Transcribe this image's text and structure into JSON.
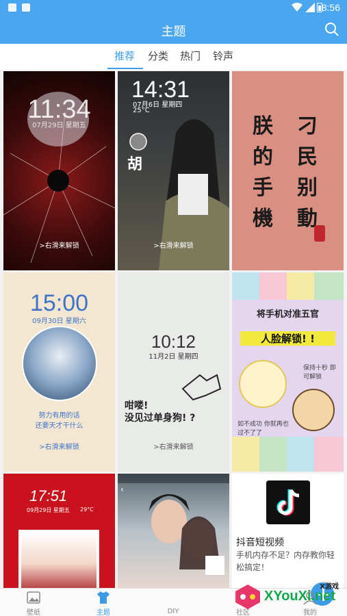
{
  "status_bar": {
    "time": "8:56"
  },
  "app_bar": {
    "title": "主题"
  },
  "tabs": [
    {
      "label": "推荐",
      "active": true
    },
    {
      "label": "分类",
      "active": false
    },
    {
      "label": "热门",
      "active": false
    },
    {
      "label": "铃声",
      "active": false
    }
  ],
  "themes": {
    "t1": {
      "time": "11:34",
      "date": "07月29日 星期五",
      "unlock": ">右滑来解锁"
    },
    "t2": {
      "time": "14:31",
      "date": "07月6日 星期四",
      "temp": "25°C",
      "name": "胡",
      "unlock": ">右滑来解锁"
    },
    "t3": {
      "chars": [
        "朕",
        "的",
        "手",
        "機",
        "刁",
        "民",
        "别",
        "動"
      ]
    },
    "t4": {
      "time": "15:00",
      "date": "09月30日 星期六",
      "quote1": "努力有用的话",
      "quote2": "还要天才干什么",
      "unlock": ">右滑来解锁"
    },
    "t5": {
      "time": "10:12",
      "date": "11月2日 星期四",
      "line1": "咁喽!",
      "line2": "没见过单身狗! ?",
      "unlock": ">右滑来解锁"
    },
    "t6": {
      "headline1": "将手机对准五官",
      "headline2": "人脸解锁! !",
      "note": "保持十秒 即可解锁",
      "note2": "如不成功 你就再也过不了了"
    },
    "t7": {
      "time": "17:51",
      "date": "09月29日 星期五",
      "temp": "29°C"
    },
    "t8": {},
    "ad": {
      "name": "抖音短视频",
      "desc": "手机内存不足？内存教你轻松搞定！"
    }
  },
  "bottom_nav": [
    {
      "label": "壁纸",
      "icon": "image-icon"
    },
    {
      "label": "主题",
      "icon": "shirt-icon",
      "active": true
    },
    {
      "label": "DIY",
      "icon": "plus-icon"
    },
    {
      "label": "社区",
      "icon": "community-icon"
    },
    {
      "label": "我的",
      "icon": "user-icon"
    }
  ],
  "watermark": {
    "small": "X游戏",
    "big": "XYouXi.net"
  },
  "colors": {
    "primary": "#4aa6ee",
    "accent": "#3b9be6"
  }
}
